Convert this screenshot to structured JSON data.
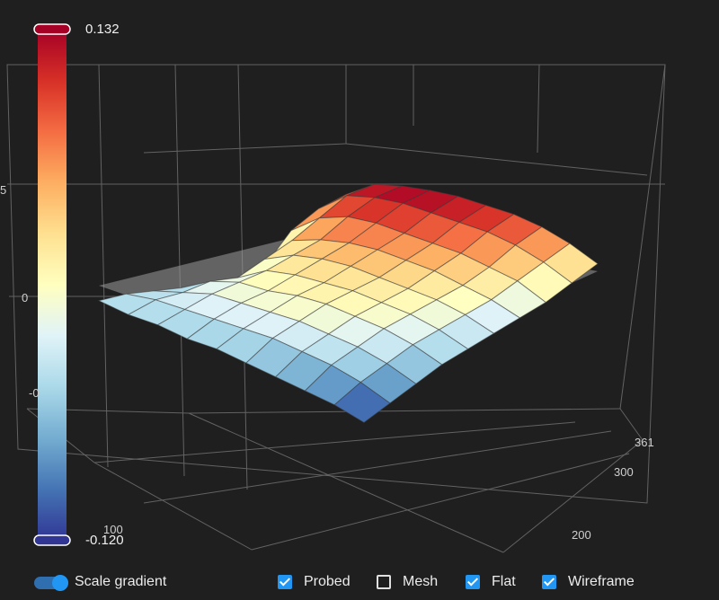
{
  "chart_data": {
    "type": "surface3d",
    "colorbar": {
      "max": 0.132,
      "min": -0.12,
      "max_label": "0.132",
      "min_label": "-0.120"
    },
    "z_ticks": [
      "5",
      "0",
      "-0"
    ],
    "x_ticks": [
      "100"
    ],
    "y_ticks": [
      "361",
      "300",
      "200"
    ],
    "x": [
      0,
      1,
      2,
      3,
      4,
      5,
      6,
      7,
      8,
      9
    ],
    "y": [
      0,
      1,
      2,
      3,
      4,
      5,
      6,
      7,
      8,
      9
    ],
    "z": [
      [
        -0.12,
        -0.1,
        -0.09,
        -0.08,
        -0.07,
        -0.06,
        -0.06,
        -0.05,
        -0.05,
        -0.04
      ],
      [
        -0.1,
        -0.07,
        -0.05,
        -0.04,
        -0.03,
        -0.03,
        -0.03,
        -0.03,
        -0.03,
        -0.04
      ],
      [
        -0.08,
        -0.05,
        -0.03,
        -0.02,
        -0.01,
        -0.01,
        -0.01,
        -0.01,
        -0.03,
        -0.05
      ],
      [
        -0.06,
        -0.03,
        -0.01,
        0.0,
        0.01,
        0.01,
        0.0,
        0.0,
        -0.02,
        -0.06
      ],
      [
        -0.05,
        -0.02,
        0.0,
        0.01,
        0.02,
        0.02,
        0.02,
        0.01,
        -0.03,
        -0.09
      ],
      [
        -0.04,
        -0.01,
        0.01,
        0.02,
        0.03,
        0.04,
        0.04,
        0.03,
        0.0,
        -0.1
      ],
      [
        -0.03,
        0.0,
        0.02,
        0.04,
        0.05,
        0.06,
        0.06,
        0.05,
        0.03,
        -0.06
      ],
      [
        -0.02,
        0.02,
        0.04,
        0.06,
        0.07,
        0.08,
        0.09,
        0.09,
        0.07,
        0.02
      ],
      [
        0.0,
        0.04,
        0.07,
        0.09,
        0.1,
        0.11,
        0.12,
        0.12,
        0.11,
        0.06
      ],
      [
        0.02,
        0.06,
        0.09,
        0.11,
        0.12,
        0.13,
        0.132,
        0.13,
        0.12,
        0.08
      ]
    ],
    "colorscale": [
      "#313695",
      "#4575b4",
      "#74add1",
      "#abd9e9",
      "#e0f3f8",
      "#ffffbf",
      "#fee090",
      "#fdae61",
      "#f46d43",
      "#d73027",
      "#a50026"
    ]
  },
  "controls": {
    "scale_gradient": {
      "label": "Scale gradient",
      "on": true
    },
    "probed": {
      "label": "Probed",
      "checked": true
    },
    "mesh": {
      "label": "Mesh",
      "checked": false
    },
    "flat": {
      "label": "Flat",
      "checked": true
    },
    "wireframe": {
      "label": "Wireframe",
      "checked": true
    }
  },
  "colors": {
    "background": "#1f1f1f",
    "accent": "#2196f3",
    "grid": "#6a6a6a",
    "flat_plane": "#9a9a9a"
  }
}
